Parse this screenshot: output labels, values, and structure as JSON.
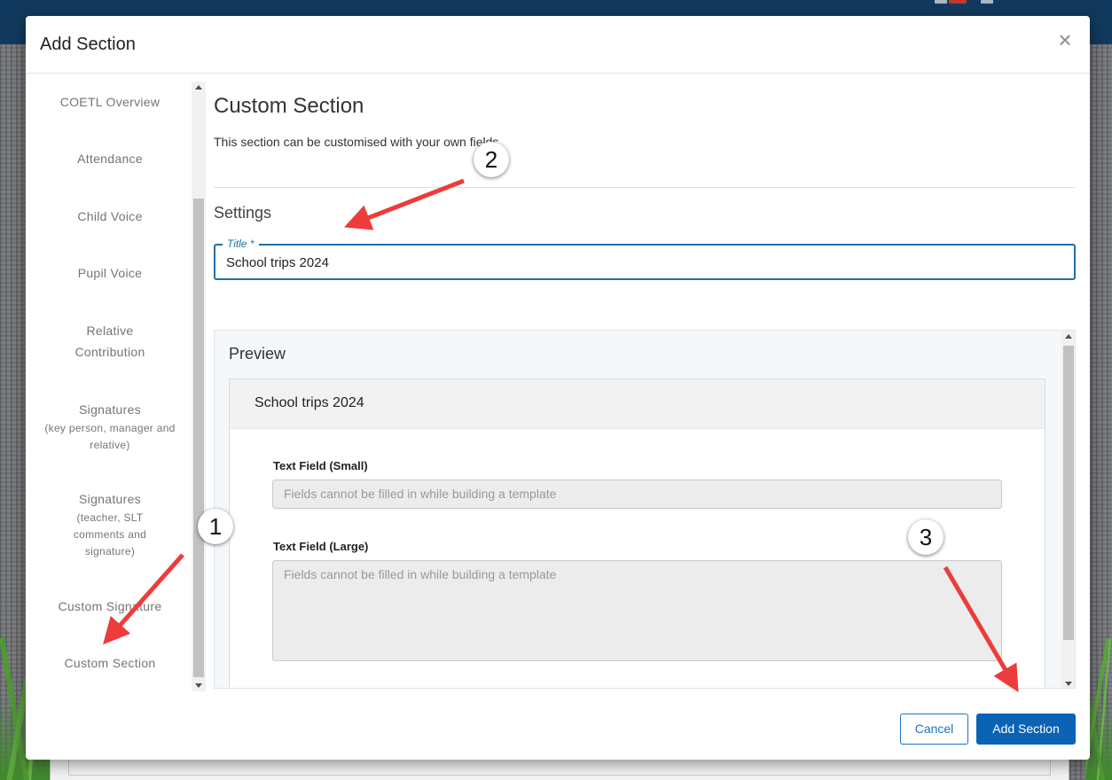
{
  "modal": {
    "title": "Add Section",
    "close_glyph": "×"
  },
  "sidebar": {
    "items": [
      {
        "label": "COETL Overview"
      },
      {
        "label": "Attendance"
      },
      {
        "label": "Child Voice"
      },
      {
        "label": "Pupil Voice"
      },
      {
        "label": "Relative Contribution"
      },
      {
        "label": "Signatures",
        "sub": "(key person, manager and relative)"
      },
      {
        "label": "Signatures",
        "sub": "(teacher, SLT comments and signature)"
      },
      {
        "label": "Custom Signature"
      },
      {
        "label": "Custom Section"
      }
    ]
  },
  "content": {
    "heading": "Custom Section",
    "description": "This section can be customised with your own fields",
    "settings_heading": "Settings",
    "title_label": "Title *",
    "title_value": "School trips 2024"
  },
  "preview": {
    "heading": "Preview",
    "card_title": "School trips 2024",
    "fields": [
      {
        "label": "Text Field (Small)",
        "placeholder": "Fields cannot be filled in while building a template"
      },
      {
        "label": "Text Field (Large)",
        "placeholder": "Fields cannot be filled in while building a template"
      }
    ]
  },
  "footer": {
    "cancel_label": "Cancel",
    "add_label": "Add Section"
  },
  "annotations": {
    "badges": [
      "1",
      "2",
      "3"
    ],
    "arrow_color": "#ee3b3b"
  },
  "colors": {
    "accent": "#0a63b5",
    "topbar": "#123a5e"
  }
}
